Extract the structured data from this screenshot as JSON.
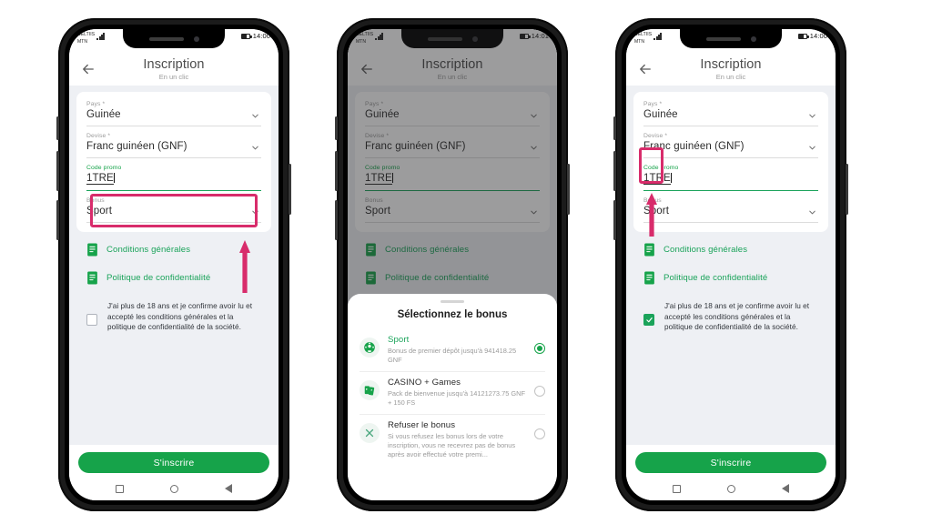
{
  "statusbar": {
    "carrier_line1": "CELTIIS",
    "carrier_line2": "MTN",
    "signal_icon": "signal-bars-icon",
    "battery_icon": "battery-icon",
    "time_p1": "14:00",
    "time_p2": "14:01",
    "time_p3": "14:00"
  },
  "header": {
    "back_icon": "back-arrow-icon",
    "title": "Inscription",
    "subtitle": "En un clic"
  },
  "form": {
    "country": {
      "label": "Pays *",
      "value": "Guinée",
      "chevron_icon": "chevron-down-icon"
    },
    "currency": {
      "label": "Devise *",
      "value": "Franc guinéen (GNF)",
      "chevron_icon": "chevron-down-icon"
    },
    "promo": {
      "label": "Code promo",
      "value": "1TRE"
    },
    "bonus": {
      "label": "Bonus",
      "value": "Sport",
      "chevron_icon": "chevron-down-icon"
    }
  },
  "links": [
    {
      "icon": "document-icon",
      "label": "Conditions générales"
    },
    {
      "icon": "document-icon",
      "label": "Politique de confidentialité"
    }
  ],
  "agreement": {
    "text": "J'ai plus de 18 ans et je confirme avoir lu et accepté les conditions générales et la politique de confidentialité de la société.",
    "checkbox_icon": "checkbox-icon",
    "check_icon": "check-mark-icon",
    "checked_p1": false,
    "checked_p3": true
  },
  "footer": {
    "signup_label": "S'inscrire"
  },
  "navbar": {
    "recents_icon": "square-icon",
    "home_icon": "circle-icon",
    "back_icon": "triangle-back-icon"
  },
  "modal": {
    "title": "Sélectionnez le bonus",
    "grabber": "drag-handle",
    "options": [
      {
        "icon": "soccer-ball-icon",
        "title": "Sport",
        "title_green": true,
        "desc": "Bonus de premier dépôt jusqu'à 941418.25 GNF",
        "selected": true
      },
      {
        "icon": "playing-cards-icon",
        "title": "CASINO + Games",
        "title_green": false,
        "desc": "Pack de bienvenue jusqu'à 14121273.75 GNF + 150 FS",
        "selected": false
      },
      {
        "icon": "x-cross-icon",
        "title": "Refuser le bonus",
        "title_green": false,
        "desc": "Si vous refusez les bonus lors de votre inscription, vous ne recevrez pas de bonus après avoir effectué votre premi...",
        "selected": false
      }
    ]
  },
  "annotations": {
    "highlight_color": "#d82c6b",
    "arrow_color": "#d82c6b",
    "arrow_p1": "up-arrow-annotation",
    "arrow_p3": "up-arrow-annotation",
    "highlight_p1_target": "bonus-field",
    "highlight_p3_target": "agreement-checkbox"
  },
  "colors": {
    "accent_green": "#16a34a",
    "link_green": "#1aa35a",
    "pink": "#d82c6b",
    "bg": "#eef0f4"
  }
}
